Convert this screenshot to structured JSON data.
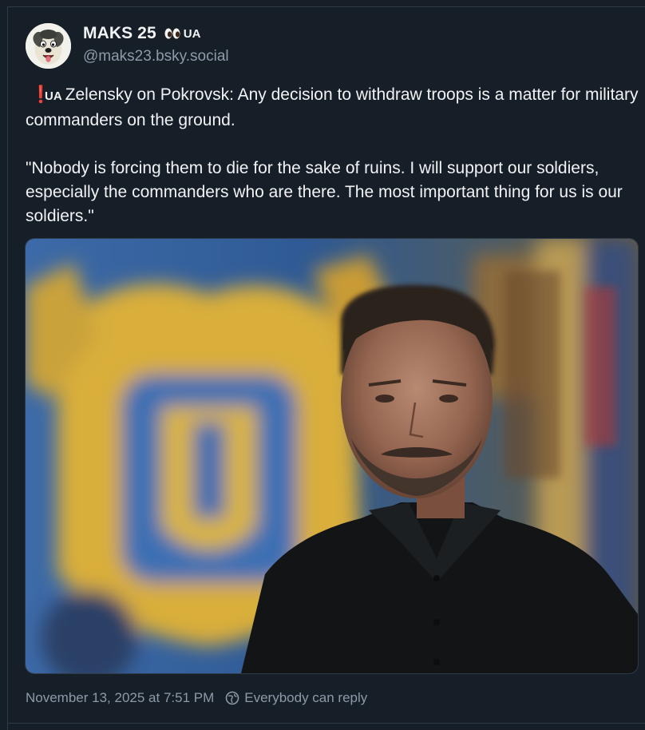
{
  "post": {
    "author": {
      "display_name": "MAKS 25",
      "name_emoji": "eyes-icon",
      "name_flag": "UA",
      "handle": "@maks23.bsky.social",
      "avatar": "cartoon-dog-avatar"
    },
    "text": {
      "line1_marker": "❗",
      "line1_flag": "UA",
      "line1": "Zelensky on Pokrovsk: Any decision to withdraw troops is a matter for military commanders on the ground.",
      "line2": "\"Nobody is forcing them to die for the sake of ruins. I will support our soldiers, especially the commanders who are there. The most important thing for us is our soldiers.\""
    },
    "image": "photo of man in black shirt in front of Ukrainian coat of arms",
    "timestamp": "November 13, 2025 at 7:51 PM",
    "reply_setting": "Everybody can reply",
    "reply_icon": "globe-icon"
  },
  "colors": {
    "background": "#161e27",
    "text_primary": "#f1f3f5",
    "text_secondary": "#8d9aa9",
    "border": "#2e3a47",
    "alert_red": "#e0323c"
  }
}
